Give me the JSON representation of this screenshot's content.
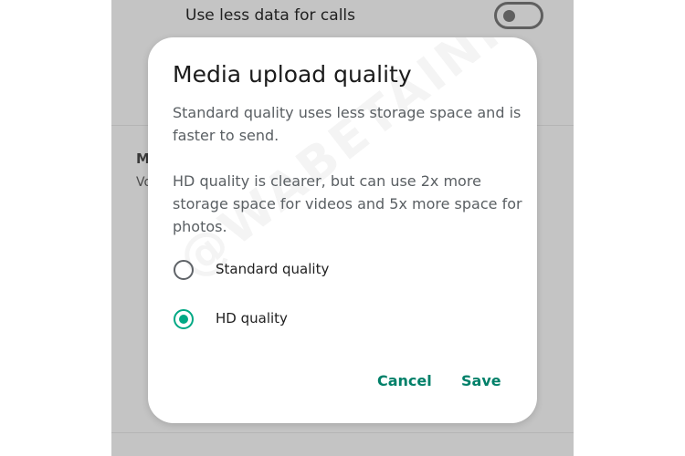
{
  "background": {
    "setting_label": "Use less data for calls",
    "section_title_partial": "M",
    "section_sub_partial": "Vo",
    "toggle_on": false
  },
  "dialog": {
    "title": "Media upload quality",
    "paragraph1": "Standard quality uses less storage space and is faster to send.",
    "paragraph2": "HD quality is clearer, but can use 2x more storage space for videos and 5x more space for photos.",
    "options": [
      {
        "label": "Standard quality",
        "selected": false
      },
      {
        "label": "HD quality",
        "selected": true
      }
    ],
    "cancel_label": "Cancel",
    "save_label": "Save",
    "watermark": "@WABETAINFO"
  },
  "colors": {
    "accent": "#00a884",
    "action_text": "#008069",
    "scrim": "#c4c4c4"
  }
}
